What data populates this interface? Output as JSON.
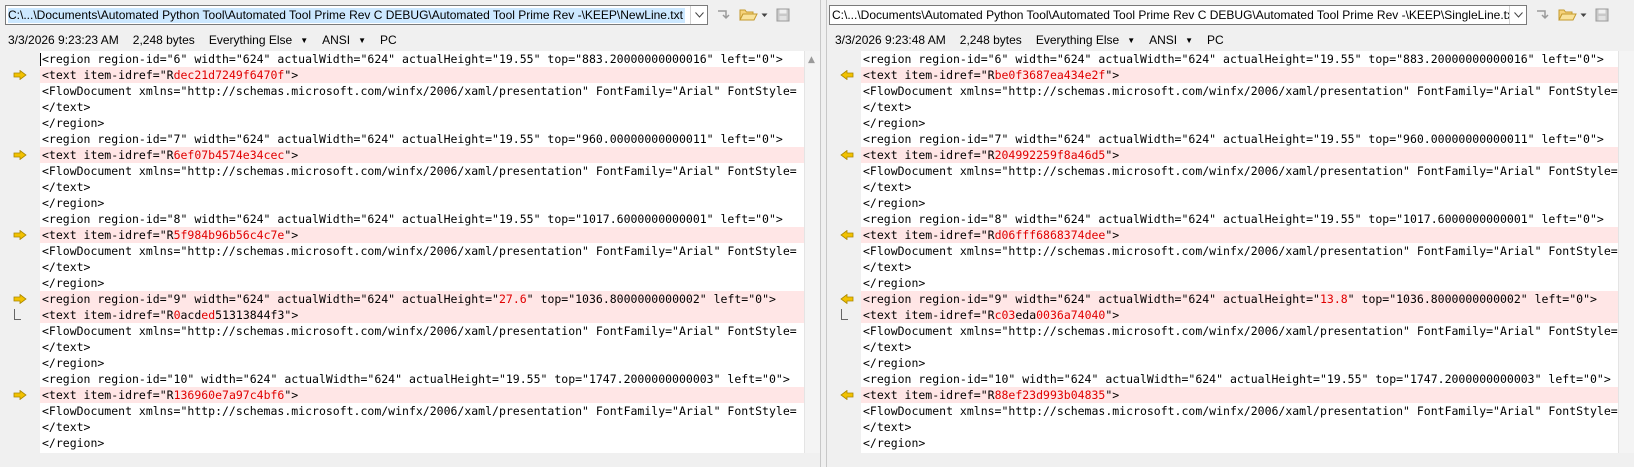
{
  "colors": {
    "diff_bg": "#ffe6e6",
    "diff_text": "#e00000",
    "selection": "#cce8ff",
    "arrow": "#f2c200"
  },
  "icons": {
    "swap": "swap-icon",
    "open": "folder-open-icon",
    "save": "save-icon",
    "dropdown": "chevron-down-icon",
    "diff_left": "arrow-right-icon",
    "diff_right": "arrow-left-icon"
  },
  "left": {
    "path": "C:\\...\\Documents\\Automated Python Tool\\Automated Tool Prime Rev C DEBUG\\Automated Tool Prime Rev -\\KEEP\\NewLine.txt",
    "timestamp": "3/3/2026 9:23:23 AM",
    "size": "2,248 bytes",
    "format": "Everything Else",
    "encoding": "ANSI",
    "line_ending": "PC",
    "lines": [
      {
        "parts": [
          "<region region-id=\"6\" width=\"624\" actualWidth=\"624\" actualHeight=\"19.55\" top=\"883.20000000000016\" left=\"0\">"
        ],
        "diff": false
      },
      {
        "parts": [
          "<text item-idref=\"R",
          "dec21d7249f6470f",
          "\">"
        ],
        "diff": true
      },
      {
        "parts": [
          "<FlowDocument xmlns=\"http://schemas.microsoft.com/winfx/2006/xaml/presentation\" FontFamily=\"Arial\" FontStyle="
        ],
        "diff": false
      },
      {
        "parts": [
          "</text>"
        ],
        "diff": false
      },
      {
        "parts": [
          "</region>"
        ],
        "diff": false
      },
      {
        "parts": [
          "<region region-id=\"7\" width=\"624\" actualWidth=\"624\" actualHeight=\"19.55\" top=\"960.00000000000011\" left=\"0\">"
        ],
        "diff": false
      },
      {
        "parts": [
          "<text item-idref=\"R",
          "6ef07b4574e34cec",
          "\">"
        ],
        "diff": true
      },
      {
        "parts": [
          "<FlowDocument xmlns=\"http://schemas.microsoft.com/winfx/2006/xaml/presentation\" FontFamily=\"Arial\" FontStyle="
        ],
        "diff": false
      },
      {
        "parts": [
          "</text>"
        ],
        "diff": false
      },
      {
        "parts": [
          "</region>"
        ],
        "diff": false
      },
      {
        "parts": [
          "<region region-id=\"8\" width=\"624\" actualWidth=\"624\" actualHeight=\"19.55\" top=\"1017.6000000000001\" left=\"0\">"
        ],
        "diff": false
      },
      {
        "parts": [
          "<text item-idref=\"R",
          "5f984b96b56c4c7e",
          "\">"
        ],
        "diff": true
      },
      {
        "parts": [
          "<FlowDocument xmlns=\"http://schemas.microsoft.com/winfx/2006/xaml/presentation\" FontFamily=\"Arial\" FontStyle="
        ],
        "diff": false
      },
      {
        "parts": [
          "</text>"
        ],
        "diff": false
      },
      {
        "parts": [
          "</region>"
        ],
        "diff": false
      },
      {
        "parts": [
          "<region region-id=\"9\" width=\"624\" actualWidth=\"624\" actualHeight=\"",
          "27.6",
          "\" top=\"1036.8000000000002\" left=\"0\">"
        ],
        "diff": true
      },
      {
        "parts": [
          "<text item-idref=\"R",
          "0",
          "acd",
          "ed",
          "51313844f3",
          "\">"
        ],
        "diff": false
      },
      {
        "parts": [
          "<FlowDocument xmlns=\"http://schemas.microsoft.com/winfx/2006/xaml/presentation\" FontFamily=\"Arial\" FontStyle="
        ],
        "diff": false
      },
      {
        "parts": [
          "</text>"
        ],
        "diff": false
      },
      {
        "parts": [
          "</region>"
        ],
        "diff": false
      },
      {
        "parts": [
          "<region region-id=\"10\" width=\"624\" actualWidth=\"624\" actualHeight=\"19.55\" top=\"1747.2000000000003\" left=\"0\">"
        ],
        "diff": false
      },
      {
        "parts": [
          "<text item-idref=\"R",
          "136960e7a97c4bf6",
          "\">"
        ],
        "diff": true
      },
      {
        "parts": [
          "<FlowDocument xmlns=\"http://schemas.microsoft.com/winfx/2006/xaml/presentation\" FontFamily=\"Arial\" FontStyle="
        ],
        "diff": false
      },
      {
        "parts": [
          "</text>"
        ],
        "diff": false
      },
      {
        "parts": [
          "</region>"
        ],
        "diff": false
      }
    ]
  },
  "right": {
    "path": "C:\\...\\Documents\\Automated Python Tool\\Automated Tool Prime Rev C DEBUG\\Automated Tool Prime Rev -\\KEEP\\SingleLine.txt",
    "timestamp": "3/3/2026 9:23:48 AM",
    "size": "2,248 bytes",
    "format": "Everything Else",
    "encoding": "ANSI",
    "line_ending": "PC",
    "lines": [
      {
        "parts": [
          "<region region-id=\"6\" width=\"624\" actualWidth=\"624\" actualHeight=\"19.55\" top=\"883.20000000000016\" left=\"0\">"
        ],
        "diff": false
      },
      {
        "parts": [
          "<text item-idref=\"R",
          "be0f3687ea434e2f",
          "\">"
        ],
        "diff": true
      },
      {
        "parts": [
          "<FlowDocument xmlns=\"http://schemas.microsoft.com/winfx/2006/xaml/presentation\" FontFamily=\"Arial\" FontStyle="
        ],
        "diff": false
      },
      {
        "parts": [
          "</text>"
        ],
        "diff": false
      },
      {
        "parts": [
          "</region>"
        ],
        "diff": false
      },
      {
        "parts": [
          "<region region-id=\"7\" width=\"624\" actualWidth=\"624\" actualHeight=\"19.55\" top=\"960.00000000000011\" left=\"0\">"
        ],
        "diff": false
      },
      {
        "parts": [
          "<text item-idref=\"R",
          "204992259f8a46d5",
          "\">"
        ],
        "diff": true
      },
      {
        "parts": [
          "<FlowDocument xmlns=\"http://schemas.microsoft.com/winfx/2006/xaml/presentation\" FontFamily=\"Arial\" FontStyle="
        ],
        "diff": false
      },
      {
        "parts": [
          "</text>"
        ],
        "diff": false
      },
      {
        "parts": [
          "</region>"
        ],
        "diff": false
      },
      {
        "parts": [
          "<region region-id=\"8\" width=\"624\" actualWidth=\"624\" actualHeight=\"19.55\" top=\"1017.6000000000001\" left=\"0\">"
        ],
        "diff": false
      },
      {
        "parts": [
          "<text item-idref=\"R",
          "d06fff6868374dee",
          "\">"
        ],
        "diff": true
      },
      {
        "parts": [
          "<FlowDocument xmlns=\"http://schemas.microsoft.com/winfx/2006/xaml/presentation\" FontFamily=\"Arial\" FontStyle="
        ],
        "diff": false
      },
      {
        "parts": [
          "</text>"
        ],
        "diff": false
      },
      {
        "parts": [
          "</region>"
        ],
        "diff": false
      },
      {
        "parts": [
          "<region region-id=\"9\" width=\"624\" actualWidth=\"624\" actualHeight=\"",
          "13.8",
          "\" top=\"1036.8000000000002\" left=\"0\">"
        ],
        "diff": true
      },
      {
        "parts": [
          "<text item-idref=\"R",
          "c03",
          "eda",
          "0036a74040",
          "\">"
        ],
        "diff": false
      },
      {
        "parts": [
          "<FlowDocument xmlns=\"http://schemas.microsoft.com/winfx/2006/xaml/presentation\" FontFamily=\"Arial\" FontStyle="
        ],
        "diff": false
      },
      {
        "parts": [
          "</text>"
        ],
        "diff": false
      },
      {
        "parts": [
          "</region>"
        ],
        "diff": false
      },
      {
        "parts": [
          "<region region-id=\"10\" width=\"624\" actualWidth=\"624\" actualHeight=\"19.55\" top=\"1747.2000000000003\" left=\"0\">"
        ],
        "diff": false
      },
      {
        "parts": [
          "<text item-idref=\"R",
          "88ef23d993b04835",
          "\">"
        ],
        "diff": true
      },
      {
        "parts": [
          "<FlowDocument xmlns=\"http://schemas.microsoft.com/winfx/2006/xaml/presentation\" FontFamily=\"Arial\" FontStyle="
        ],
        "diff": false
      },
      {
        "parts": [
          "</text>"
        ],
        "diff": false
      },
      {
        "parts": [
          "</region>"
        ],
        "diff": false
      }
    ]
  }
}
